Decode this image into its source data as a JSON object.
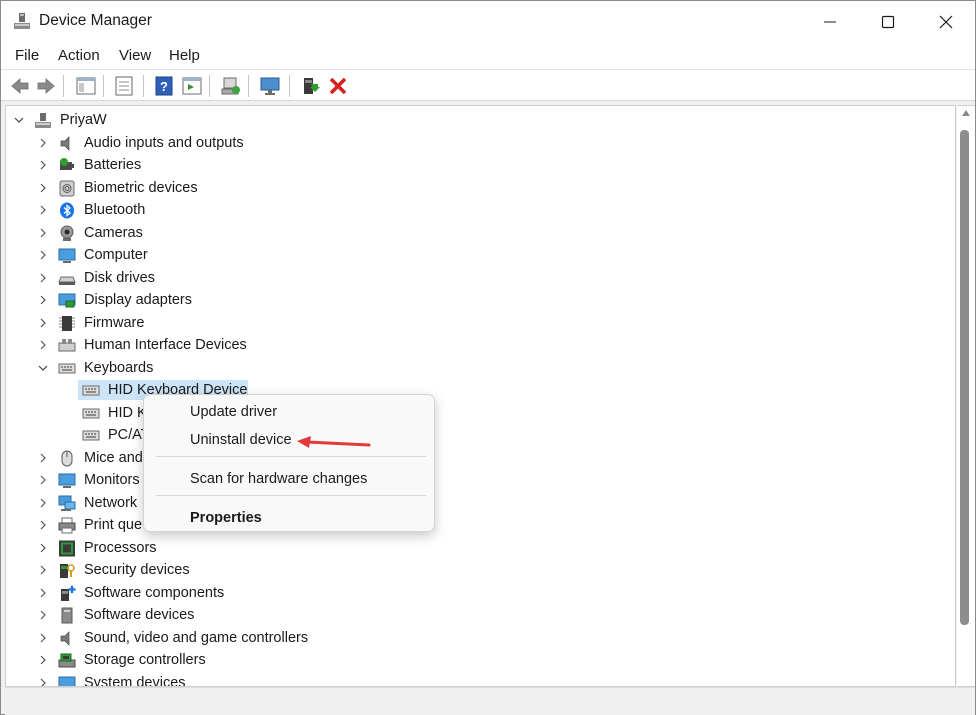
{
  "window": {
    "title": "Device Manager",
    "icon": "device-manager-icon"
  },
  "menu": [
    "File",
    "Action",
    "View",
    "Help"
  ],
  "toolbar_icons": [
    "back-arrow-icon",
    "forward-arrow-icon",
    "show-hide-console-tree-icon",
    "properties-icon",
    "help-icon",
    "action-pane-icon",
    "scan-hardware-icon",
    "monitor-icon",
    "update-driver-icon",
    "uninstall-icon"
  ],
  "tree": {
    "root": "PriyaW",
    "categories": [
      {
        "label": "Audio inputs and outputs",
        "icon": "speaker-icon"
      },
      {
        "label": "Batteries",
        "icon": "battery-icon"
      },
      {
        "label": "Biometric devices",
        "icon": "fingerprint-icon"
      },
      {
        "label": "Bluetooth",
        "icon": "bluetooth-icon"
      },
      {
        "label": "Cameras",
        "icon": "camera-icon"
      },
      {
        "label": "Computer",
        "icon": "computer-icon"
      },
      {
        "label": "Disk drives",
        "icon": "disk-drive-icon"
      },
      {
        "label": "Display adapters",
        "icon": "display-adapter-icon"
      },
      {
        "label": "Firmware",
        "icon": "firmware-chip-icon"
      },
      {
        "label": "Human Interface Devices",
        "icon": "hid-icon"
      },
      {
        "label": "Keyboards",
        "icon": "keyboard-icon",
        "expanded": true,
        "children": [
          {
            "label": "HID Keyboard Device",
            "selected": true
          },
          {
            "label": "HID K"
          },
          {
            "label": "PC/AT"
          }
        ]
      },
      {
        "label": "Mice and",
        "icon": "mouse-icon"
      },
      {
        "label": "Monitors",
        "icon": "monitor-icon"
      },
      {
        "label": "Network",
        "icon": "network-icon"
      },
      {
        "label": "Print que",
        "icon": "printer-icon"
      },
      {
        "label": "Processors",
        "icon": "processor-icon"
      },
      {
        "label": "Security devices",
        "icon": "security-icon"
      },
      {
        "label": "Software components",
        "icon": "software-component-icon"
      },
      {
        "label": "Software devices",
        "icon": "software-device-icon"
      },
      {
        "label": "Sound, video and game controllers",
        "icon": "sound-icon"
      },
      {
        "label": "Storage controllers",
        "icon": "storage-controller-icon"
      },
      {
        "label": "System devices",
        "icon": "system-devices-icon"
      }
    ]
  },
  "context_menu": {
    "items": [
      "Update driver",
      "Uninstall device",
      "Scan for hardware changes",
      "Properties"
    ]
  },
  "colors": {
    "selection": "#cce4f7",
    "accent_arrow": "#e03a3a",
    "uninstall_red": "#d81e1e"
  }
}
